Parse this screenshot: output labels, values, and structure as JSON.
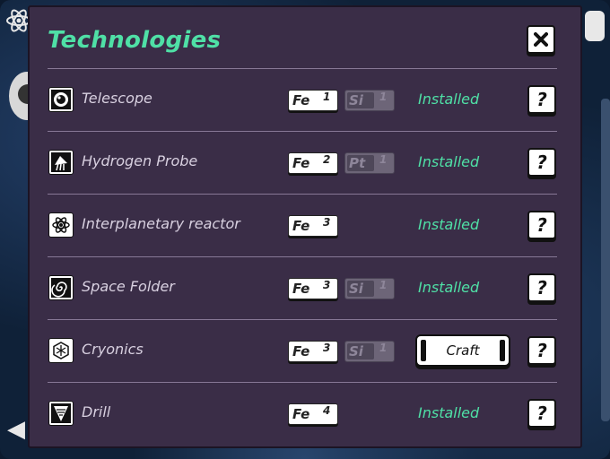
{
  "panel": {
    "title": "Technologies",
    "close_icon": "close-icon",
    "accent_color": "#4fe0a6",
    "background_color": "#3a2d47"
  },
  "technologies": [
    {
      "name": "Telescope",
      "icon": "telescope-icon",
      "resources": [
        {
          "symbol": "Fe",
          "qty": "1",
          "available": true
        },
        {
          "symbol": "Si",
          "qty": "1",
          "available": false
        }
      ],
      "status": "Installed",
      "help_label": "?"
    },
    {
      "name": "Hydrogen Probe",
      "icon": "hydrogen-probe-icon",
      "resources": [
        {
          "symbol": "Fe",
          "qty": "2",
          "available": true
        },
        {
          "symbol": "Pt",
          "qty": "1",
          "available": false
        }
      ],
      "status": "Installed",
      "help_label": "?"
    },
    {
      "name": "Interplanetary reactor",
      "icon": "atom-icon",
      "resources": [
        {
          "symbol": "Fe",
          "qty": "3",
          "available": true
        }
      ],
      "status": "Installed",
      "help_label": "?"
    },
    {
      "name": "Space Folder",
      "icon": "spiral-icon",
      "resources": [
        {
          "symbol": "Fe",
          "qty": "3",
          "available": true
        },
        {
          "symbol": "Si",
          "qty": "1",
          "available": false
        }
      ],
      "status": "Installed",
      "help_label": "?"
    },
    {
      "name": "Cryonics",
      "icon": "snowflake-icon",
      "resources": [
        {
          "symbol": "Fe",
          "qty": "3",
          "available": true
        },
        {
          "symbol": "Si",
          "qty": "1",
          "available": false
        }
      ],
      "craft_label": "Craft",
      "help_label": "?"
    },
    {
      "name": "Drill",
      "icon": "drill-icon",
      "resources": [
        {
          "symbol": "Fe",
          "qty": "4",
          "available": true
        }
      ],
      "status": "Installed",
      "help_label": "?"
    }
  ]
}
